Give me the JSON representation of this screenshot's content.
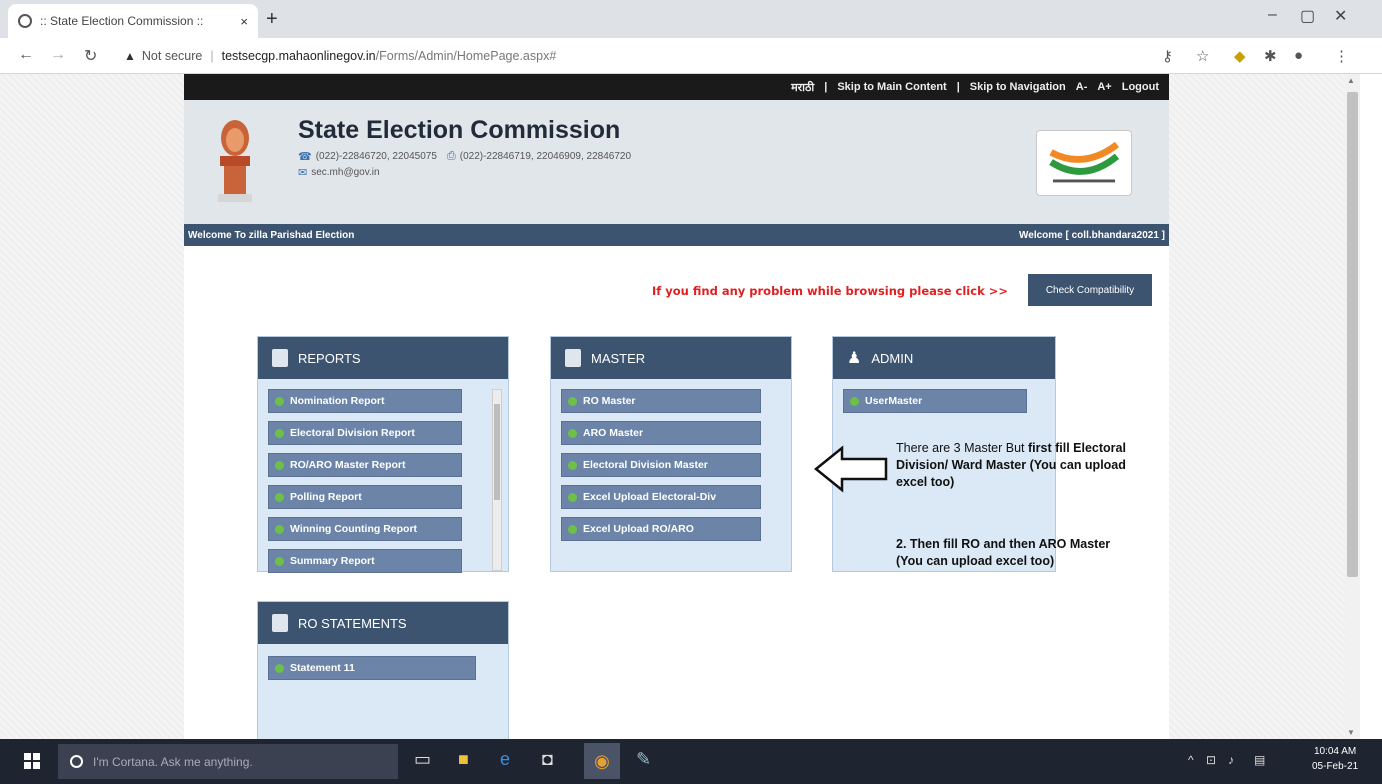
{
  "browser": {
    "tab_title": ":: State Election Commission ::",
    "tab_close": "×",
    "new_tab": "+",
    "window_controls": [
      "–",
      "▢",
      "✕"
    ],
    "security_label": "Not secure",
    "url_host": "testsecgp.mahaonlinegov.in",
    "url_path": "/Forms/Admin/HomePage.aspx#"
  },
  "topstrip": {
    "marathi": "मराठी",
    "sep1": "|",
    "skip_main": "Skip to Main Content",
    "sep2": "|",
    "skip_nav": "Skip to Navigation",
    "font_dec": "A-",
    "font_inc": "A+",
    "logout": "Logout"
  },
  "header": {
    "title": "State Election Commission",
    "phone": "(022)-22846720, 22045075",
    "fax": "(022)-22846719, 22046909, 22846720",
    "email": "sec.mh@gov.in",
    "welcome_left": "Welcome To zilla Parishad Election",
    "welcome_right": "Welcome [ coll.bhandara2021 ]"
  },
  "notice": {
    "text": "If you find any problem while browsing please click >>",
    "button": "Check Compatibility"
  },
  "panels": {
    "reports": {
      "title": "REPORTS",
      "items": [
        "Nomination Report",
        "Electoral Division Report",
        "RO/ARO Master Report",
        "Polling Report",
        "Winning Counting Report",
        "Summary Report"
      ]
    },
    "master": {
      "title": "MASTER",
      "items": [
        "RO Master",
        "ARO Master",
        "Electoral Division Master",
        "Excel Upload Electoral-Div",
        "Excel Upload RO/ARO"
      ]
    },
    "admin": {
      "title": "ADMIN",
      "items": [
        "UserMaster"
      ]
    },
    "ro_statements": {
      "title": "RO STATEMENTS",
      "items": [
        "Statement 11"
      ]
    }
  },
  "annotation": {
    "line1_normal": "There are 3 Master But ",
    "line1_bold": "first fill Electoral Division/ Ward Master (You can upload excel too)",
    "line2": "2. Then fill RO and then ARO Master (You can upload excel too)"
  },
  "taskbar": {
    "search_placeholder": "I'm Cortana. Ask me anything.",
    "time": "10:04 AM",
    "date": "05-Feb-21"
  }
}
